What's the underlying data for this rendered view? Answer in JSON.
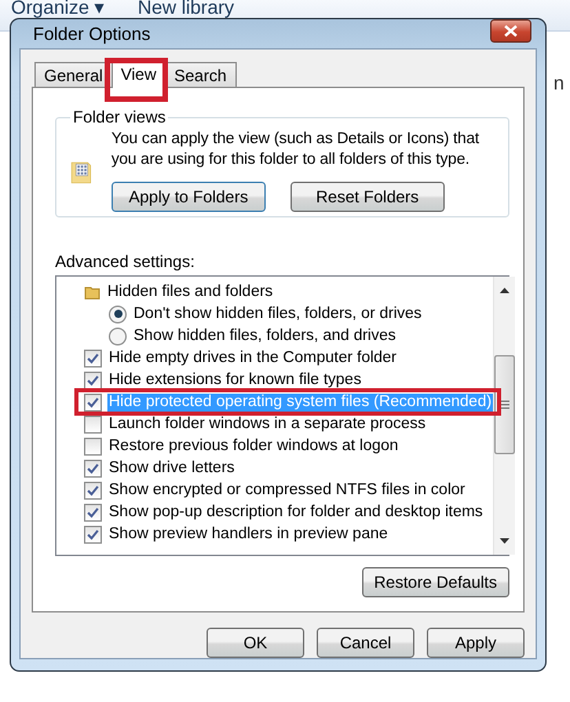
{
  "explorer_toolbar": {
    "organize": "Organize",
    "organize_caret": "▾",
    "new_library": "New library",
    "side_text": "n"
  },
  "window": {
    "title": "Folder Options"
  },
  "tabs": [
    {
      "label": "General",
      "selected": false
    },
    {
      "label": "View",
      "selected": true
    },
    {
      "label": "Search",
      "selected": false
    }
  ],
  "folder_views": {
    "title": "Folder views",
    "description": "You can apply the view (such as Details or Icons) that you are using for this folder to all folders of this type.",
    "buttons": [
      "Apply to Folders",
      "Reset Folders"
    ]
  },
  "advanced_settings": {
    "label": "Advanced settings:",
    "items": [
      {
        "kind": "folder",
        "label": "Hidden files and folders",
        "children": [
          {
            "kind": "radio",
            "label": "Don't show hidden files, folders, or drives",
            "selected": true
          },
          {
            "kind": "radio",
            "label": "Show hidden files, folders, and drives",
            "selected": false
          }
        ]
      },
      {
        "kind": "checkbox",
        "label": "Hide empty drives in the Computer folder",
        "checked": true,
        "selected": false
      },
      {
        "kind": "checkbox",
        "label": "Hide extensions for known file types",
        "checked": true,
        "selected": false
      },
      {
        "kind": "checkbox",
        "label": "Hide protected operating system files (Recommended)",
        "checked": true,
        "selected": true
      },
      {
        "kind": "checkbox",
        "label": "Launch folder windows in a separate process",
        "checked": false,
        "selected": false
      },
      {
        "kind": "checkbox",
        "label": "Restore previous folder windows at logon",
        "checked": false,
        "selected": false
      },
      {
        "kind": "checkbox",
        "label": "Show drive letters",
        "checked": true,
        "selected": false
      },
      {
        "kind": "checkbox",
        "label": "Show encrypted or compressed NTFS files in color",
        "checked": true,
        "selected": false
      },
      {
        "kind": "checkbox",
        "label": "Show pop-up description for folder and desktop items",
        "checked": true,
        "selected": false
      },
      {
        "kind": "checkbox",
        "label": "Show preview handlers in preview pane",
        "checked": true,
        "selected": false
      }
    ]
  },
  "restore_button": "Restore Defaults",
  "dialog_buttons": [
    "OK",
    "Cancel",
    "Apply"
  ]
}
